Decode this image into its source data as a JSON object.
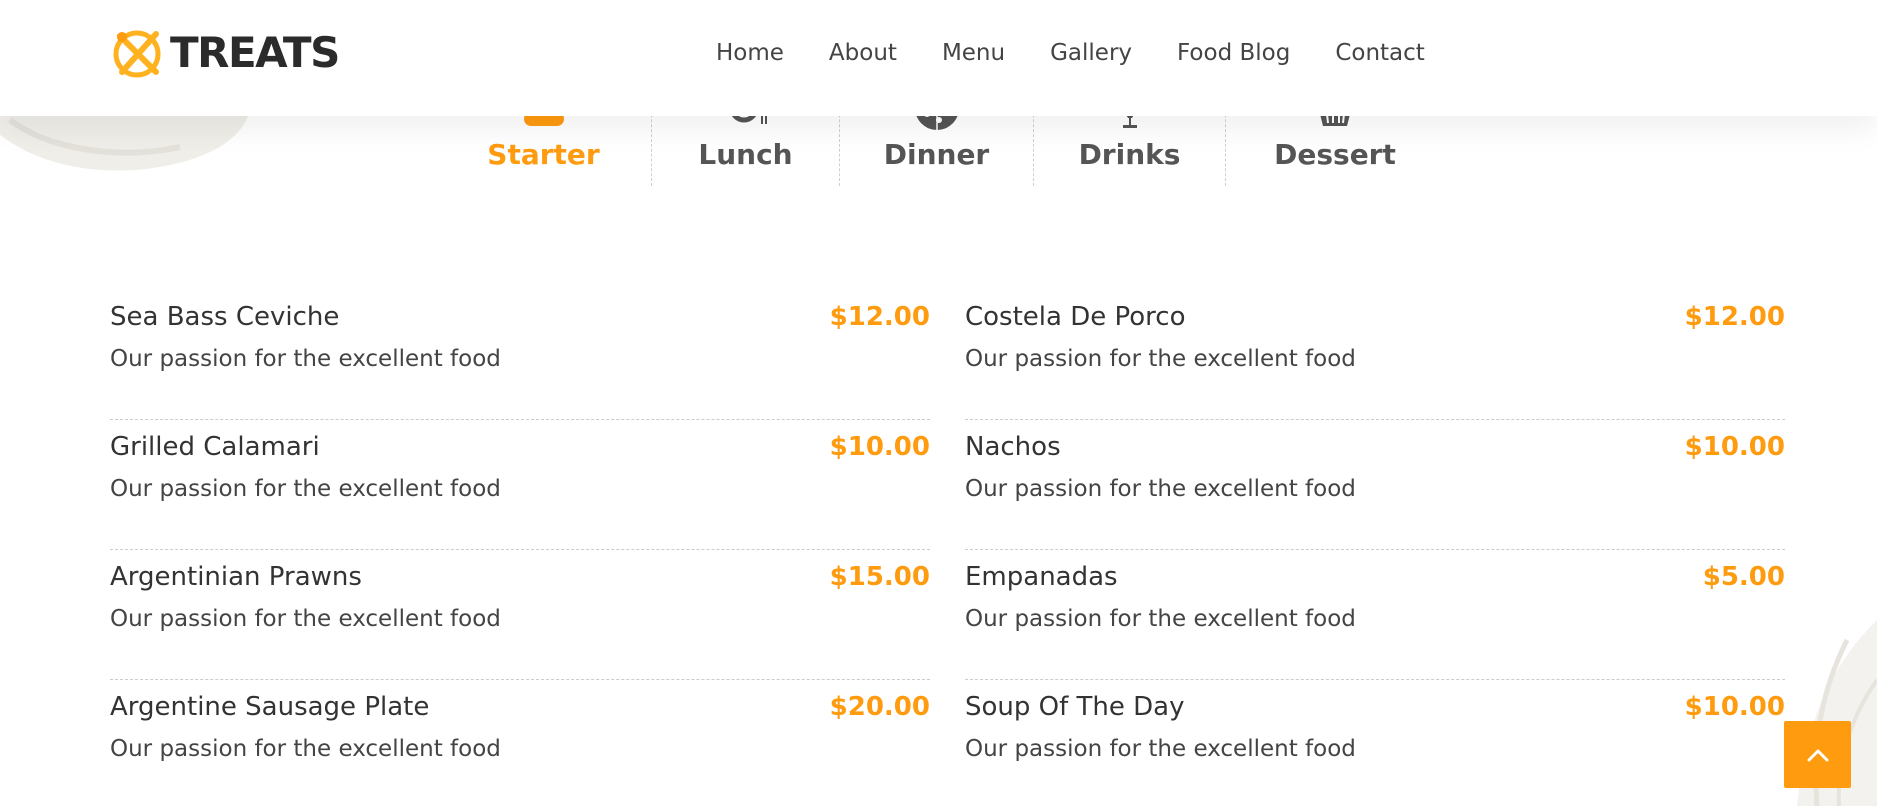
{
  "brand": {
    "name": "TREATS",
    "accent": "#ff9b0f"
  },
  "nav": {
    "items": [
      {
        "label": "Home"
      },
      {
        "label": "About"
      },
      {
        "label": "Menu"
      },
      {
        "label": "Gallery"
      },
      {
        "label": "Food Blog"
      },
      {
        "label": "Contact"
      }
    ]
  },
  "tabs": [
    {
      "label": "Starter",
      "icon": "burger-icon",
      "active": true
    },
    {
      "label": "Lunch",
      "icon": "plate-cutlery-icon",
      "active": false
    },
    {
      "label": "Dinner",
      "icon": "pizza-icon",
      "active": false
    },
    {
      "label": "Drinks",
      "icon": "glass-icon",
      "active": false
    },
    {
      "label": "Dessert",
      "icon": "cupcake-icon",
      "active": false
    }
  ],
  "menu": {
    "left": [
      {
        "name": "Sea Bass Ceviche",
        "price": "$12.00",
        "description": "Our passion for the excellent food"
      },
      {
        "name": "Grilled Calamari",
        "price": "$10.00",
        "description": "Our passion for the excellent food"
      },
      {
        "name": "Argentinian Prawns",
        "price": "$15.00",
        "description": "Our passion for the excellent food"
      },
      {
        "name": "Argentine Sausage Plate",
        "price": "$20.00",
        "description": "Our passion for the excellent food"
      }
    ],
    "right": [
      {
        "name": "Costela De Porco",
        "price": "$12.00",
        "description": "Our passion for the excellent food"
      },
      {
        "name": "Nachos",
        "price": "$10.00",
        "description": "Our passion for the excellent food"
      },
      {
        "name": "Empanadas",
        "price": "$5.00",
        "description": "Our passion for the excellent food"
      },
      {
        "name": "Soup Of The Day",
        "price": "$10.00",
        "description": "Our passion for the excellent food"
      }
    ]
  },
  "back_to_top": {
    "icon": "chevron-up-icon"
  }
}
